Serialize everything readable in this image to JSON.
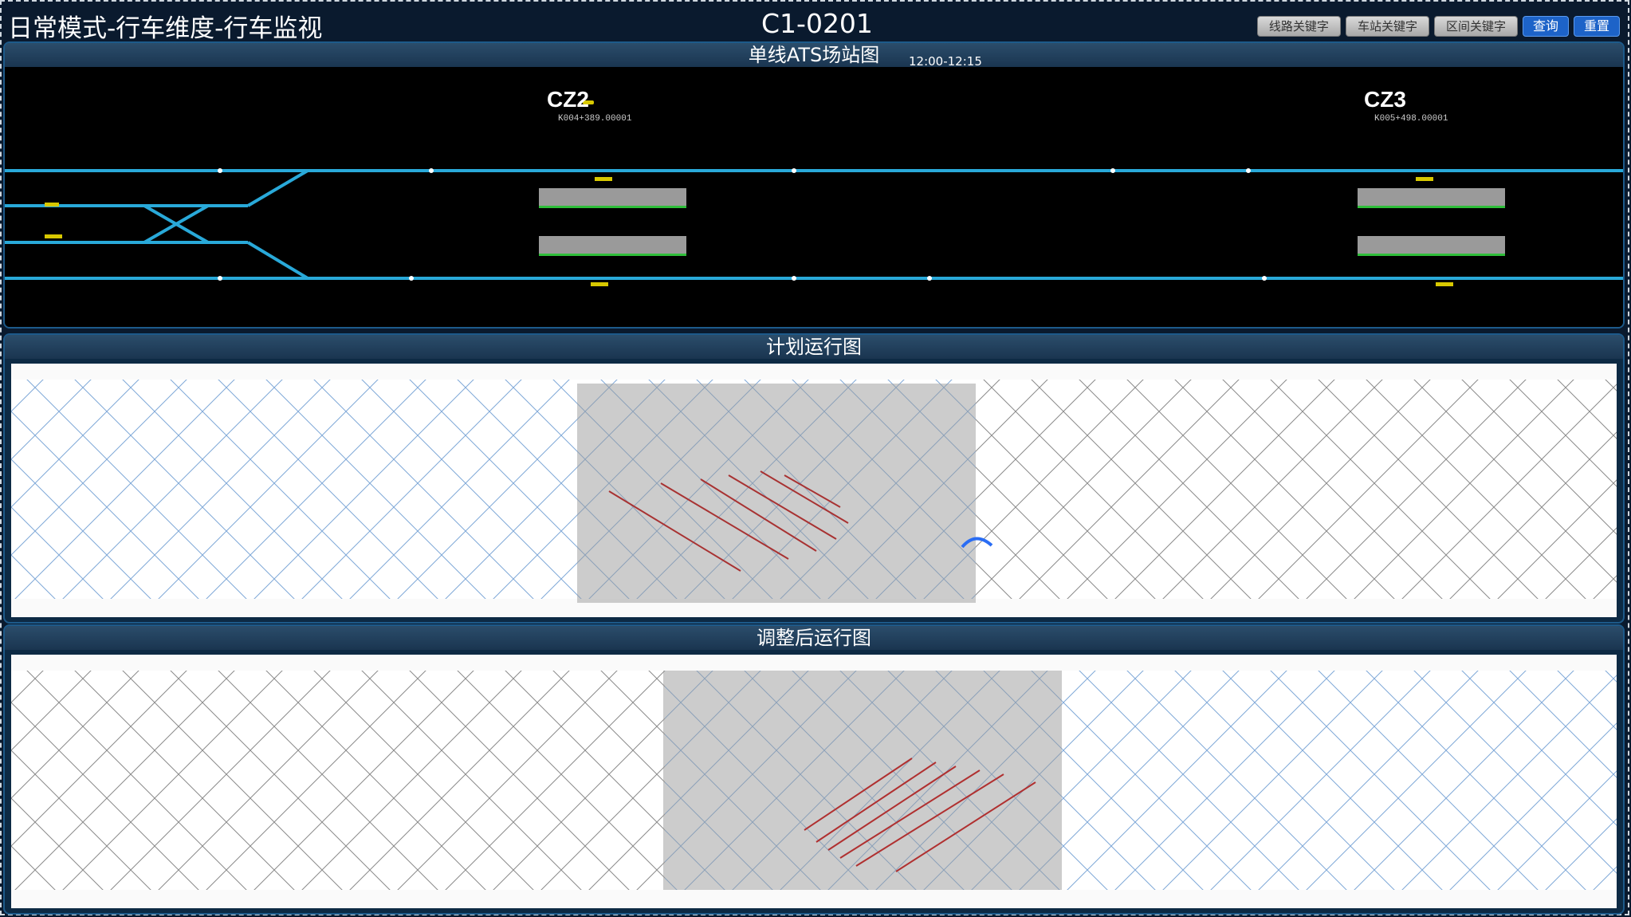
{
  "header": {
    "title": "日常模式-行车维度-行车监视",
    "line_code": "C1-0201",
    "buttons": {
      "line_keyword": "线路关键字",
      "station_keyword": "车站关键字",
      "section_keyword": "区间关键字",
      "query": "查询",
      "reset": "重置"
    }
  },
  "ats_panel": {
    "title": "单线ATS场站图",
    "time_range": "12:00-12:15",
    "stations": [
      {
        "name": "CZ2",
        "mileage": "K004+389.00001"
      },
      {
        "name": "CZ3",
        "mileage": "K005+498.00001"
      }
    ]
  },
  "plan_panel": {
    "title": "计划运行图"
  },
  "adjusted_panel": {
    "title": "调整后运行图"
  },
  "colors": {
    "track": "#29a9d9",
    "platform": "#9a9a9a",
    "platform_edge": "#2fbf3a",
    "highlight_lines": "#c0392b",
    "panel_border": "#1d5a8a",
    "query_button": "#1d63c8"
  }
}
